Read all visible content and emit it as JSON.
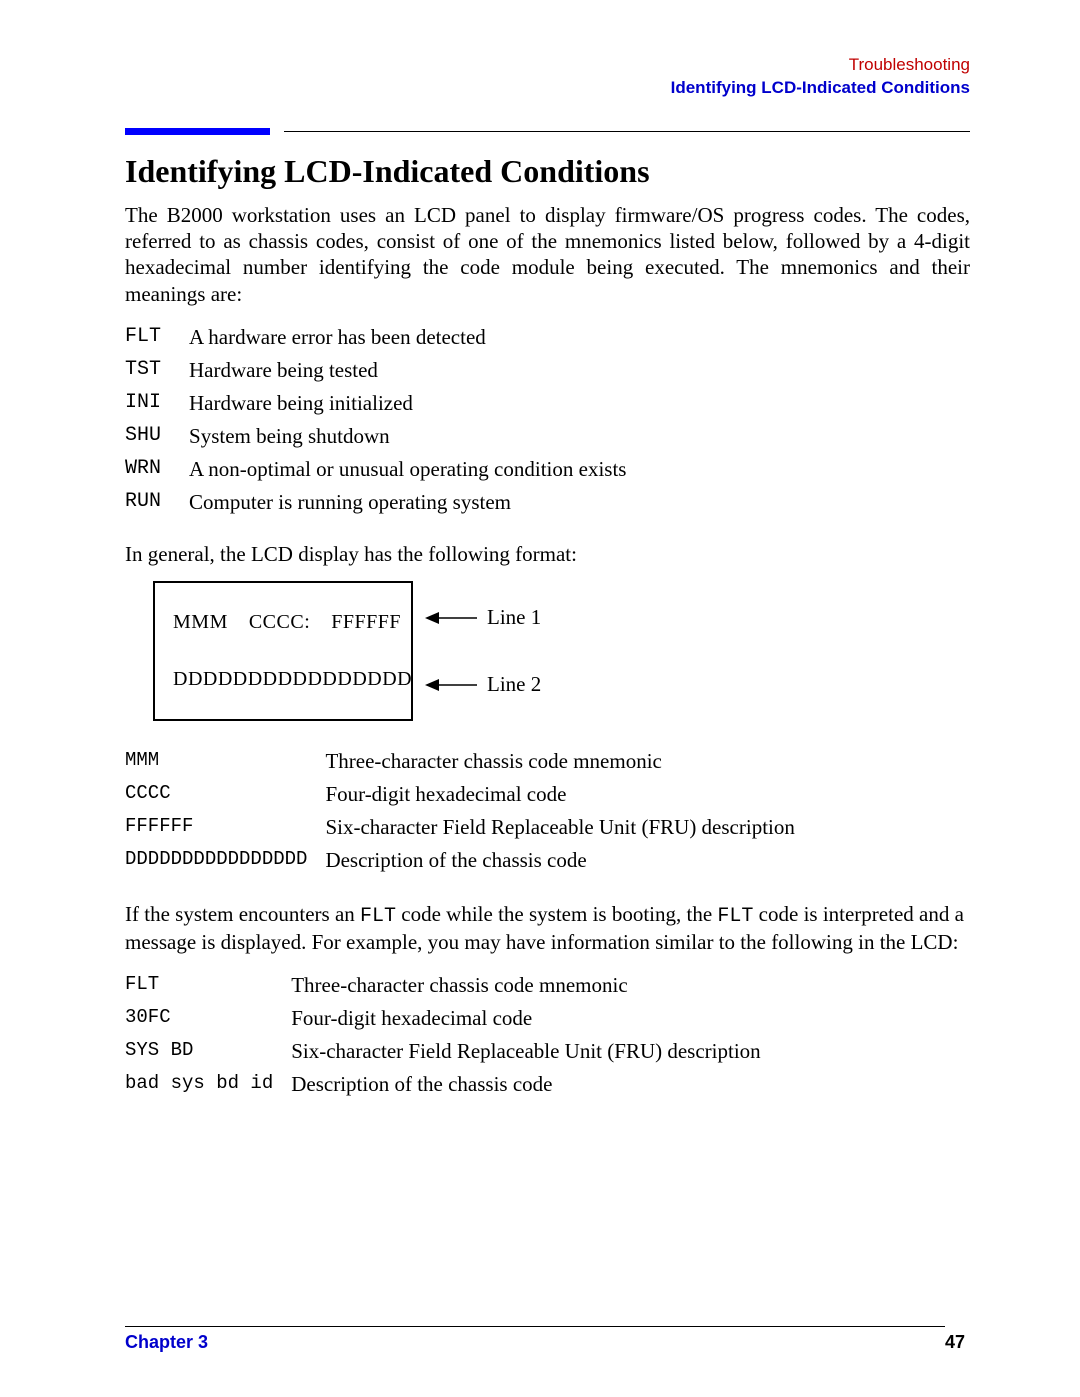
{
  "header": {
    "chapter_name": "Troubleshooting",
    "section_name": "Identifying LCD-Indicated Conditions"
  },
  "section": {
    "title": "Identifying LCD-Indicated Conditions",
    "intro": "The B2000 workstation uses an LCD panel to display firmware/OS progress codes. The codes, referred to as chassis codes, consist of one of the mnemonics listed below, followed by a 4-digit hexadecimal number identifying the code module being executed. The mnemonics and their meanings are:"
  },
  "mnemonics": [
    {
      "code": "FLT",
      "desc": "A hardware error has been detected"
    },
    {
      "code": "TST",
      "desc": "Hardware being tested"
    },
    {
      "code": "INI",
      "desc": "Hardware being initialized"
    },
    {
      "code": "SHU",
      "desc": "System being shutdown"
    },
    {
      "code": "WRN",
      "desc": "A non-optimal or unusual operating condition exists"
    },
    {
      "code": "RUN",
      "desc": "Computer is running operating system"
    }
  ],
  "format_intro": "In general, the LCD display has the following format:",
  "lcd": {
    "line1_a": "MMM",
    "line1_b": "CCCC:",
    "line1_c": "FFFFFF",
    "line2": "DDDDDDDDDDDDDDDD",
    "label1": "Line 1",
    "label2": "Line 2"
  },
  "format_fields": [
    {
      "code": "MMM",
      "desc": "Three-character chassis code mnemonic"
    },
    {
      "code": "CCCC",
      "desc": "Four-digit hexadecimal code"
    },
    {
      "code": "FFFFFF",
      "desc": "Six-character Field Replaceable Unit (FRU) description"
    },
    {
      "code": "DDDDDDDDDDDDDDDD",
      "desc": "Description of the chassis code"
    }
  ],
  "flt_para_pre": "If the system encounters an ",
  "flt_code1": "FLT",
  "flt_para_mid": " code while the system is booting, the ",
  "flt_code2": "FLT",
  "flt_para_post": " code is interpreted and a message is displayed. For example, you may have information similar to the following in the LCD:",
  "flt_example": [
    {
      "code": "FLT",
      "desc": "Three-character chassis code mnemonic"
    },
    {
      "code": "30FC",
      "desc": "Four-digit hexadecimal code"
    },
    {
      "code": "SYS BD",
      "desc": "Six-character Field Replaceable Unit (FRU) description"
    },
    {
      "code": "bad sys bd id",
      "desc": "Description of the chassis code"
    }
  ],
  "footer": {
    "left": "Chapter 3",
    "right": "47"
  }
}
